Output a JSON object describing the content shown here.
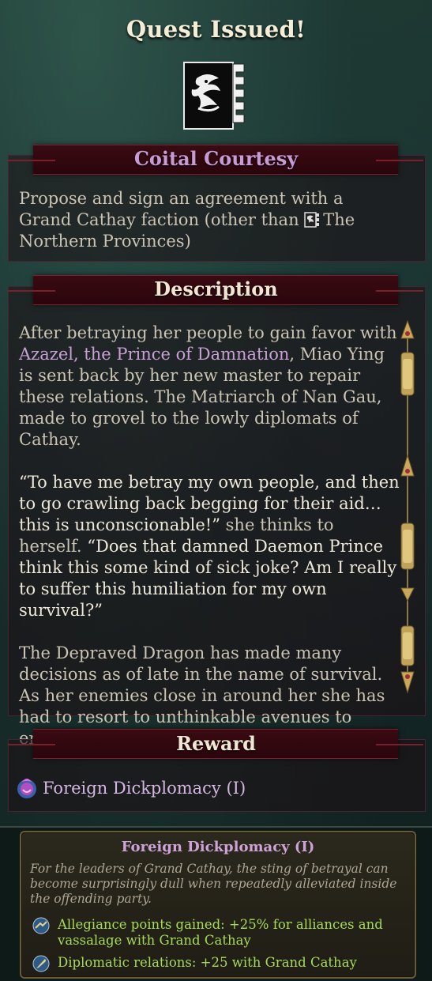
{
  "title": "Quest Issued!",
  "quest": {
    "icon": "dragon-banner-icon",
    "name": "Coital Courtesy",
    "objective_pre": "Propose and sign an agreement with a Grand Cathay faction (other than ",
    "objective_faction": "The Northern Provinces",
    "objective_post": ")"
  },
  "description": {
    "header": "Description",
    "p1_pre": "After betraying her people to gain favor with ",
    "p1_highlight": "Azazel, the Prince of Damnation",
    "p1_post": ", Miao Ying is sent back by her new master to repair these relations. The Matriarch of Nan Gau, made to grovel to the lowly diplomats of Cathay.",
    "p2_quote1": "“To have me betray my own people, and then to go crawling back begging for their aid… this is unconscionable!”",
    "p2_mid": " she thinks to herself. ",
    "p2_quote2": "“Does that damned Daemon Prince think this some kind of sick joke? Am I really to suffer this humiliation for my own survival?”",
    "p3": "The Depraved Dragon has made many decisions as of late in the name of survival. As her enemies close in around her she has had to resort to unthinkable avenues to ensure the safety of Cathay…"
  },
  "reward": {
    "header": "Reward",
    "item_label": "Foreign Dickplomacy (I)",
    "item_icon": "dilemma-reward-icon"
  },
  "tooltip": {
    "title": "Foreign Dickplomacy (I)",
    "description": "For the leaders of Grand Cathay, the sting of betrayal can become surprisingly dull when repeatedly alleviated inside the offending party.",
    "effects": [
      {
        "icon": "allegiance-icon",
        "text": "Allegiance points gained: +25% for alliances and vassalage with Grand Cathay"
      },
      {
        "icon": "diplomacy-quill-icon",
        "text": "Diplomatic relations: +25 with Grand Cathay"
      }
    ]
  },
  "colors": {
    "quest_name": "#c89ad6",
    "header_text": "#f0e7d2",
    "effect_green": "#a6dc57"
  }
}
